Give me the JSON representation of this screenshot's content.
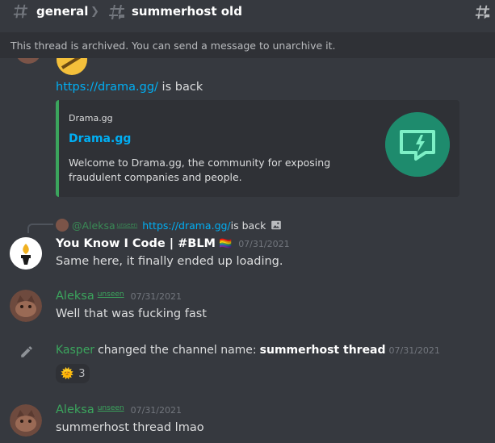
{
  "header": {
    "channel": "general",
    "thread": "summerhost old"
  },
  "archived_notice": "This thread is archived. You can send a message to unarchive it.",
  "messages": {
    "top_text_link": "https://drama.gg/",
    "top_text_rest": " is back",
    "embed": {
      "provider": "Drama.gg",
      "title": "Drama.gg",
      "description": "Welcome to Drama.gg, the community for exposing fraudulent companies and people."
    },
    "reply": {
      "author": "@Aleksa",
      "tag": "unseen",
      "preview_link": "https://drama.gg/",
      "preview_rest": " is back"
    },
    "msg1": {
      "author": "You Know I Code | #BLM",
      "badge": "🏳️‍🌈",
      "timestamp": "07/31/2021",
      "text": "Same here, it finally ended up loading."
    },
    "msg2": {
      "author": "Aleksa",
      "tag": "unseen",
      "timestamp": "07/31/2021",
      "text": "Well that was fucking fast"
    },
    "system": {
      "author": "Kasper",
      "text": "changed the channel name:",
      "channel": "summerhost thread",
      "timestamp": "07/31/2021"
    },
    "reaction": {
      "emoji": "🌞",
      "count": "3"
    },
    "msg3": {
      "author": "Aleksa",
      "tag": "unseen",
      "timestamp": "07/31/2021",
      "text": "summerhost thread lmao"
    }
  },
  "colors": {
    "background": "#36393f",
    "link": "#00aff4",
    "green_name": "#3ba55d",
    "embed_accent": "#3ba55d",
    "embed_thumb": "#1e8b6d"
  }
}
